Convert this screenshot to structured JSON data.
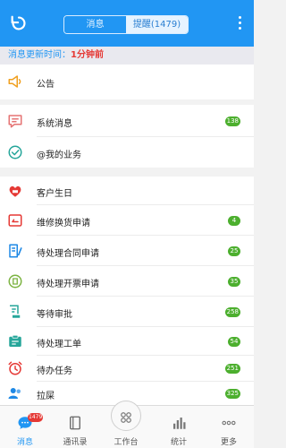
{
  "header": {
    "tabs": [
      {
        "label": "消息"
      },
      {
        "label": "提醒(1479)"
      }
    ]
  },
  "update_bar": {
    "label": "消息更新时间：",
    "value": "1分钟前"
  },
  "rows": [
    {
      "label": "公告",
      "icon": "megaphone-icon",
      "color": "#f0a020",
      "badge": ""
    },
    {
      "label": "系统消息",
      "icon": "chat-icon",
      "color": "#e57373",
      "badge": "138"
    },
    {
      "label": "@我的业务",
      "icon": "check-circle-icon",
      "color": "#26a69a",
      "badge": ""
    },
    {
      "label": "客户生日",
      "icon": "birthday-icon",
      "color": "#e53935",
      "badge": ""
    },
    {
      "label": "维修换货申请",
      "icon": "exchange-icon",
      "color": "#e53935",
      "badge": "4"
    },
    {
      "label": "待处理合同申请",
      "icon": "contract-edit-icon",
      "color": "#1e88e5",
      "badge": "25"
    },
    {
      "label": "待处理开票申请",
      "icon": "invoice-icon",
      "color": "#7cb342",
      "badge": "35"
    },
    {
      "label": "等待审批",
      "icon": "approval-icon",
      "color": "#26a69a",
      "badge": "258"
    },
    {
      "label": "待处理工单",
      "icon": "work-order-icon",
      "color": "#26a69a",
      "badge": "54"
    },
    {
      "label": "待办任务",
      "icon": "alarm-clock-icon",
      "color": "#e53935",
      "badge": "251"
    },
    {
      "label": "拉屎",
      "icon": "contacts-icon",
      "color": "#1e88e5",
      "badge": "325"
    }
  ],
  "tabbar": [
    {
      "label": "消息",
      "badge": "1479"
    },
    {
      "label": "通讯录"
    },
    {
      "label": "工作台"
    },
    {
      "label": "统计"
    },
    {
      "label": "更多"
    }
  ]
}
